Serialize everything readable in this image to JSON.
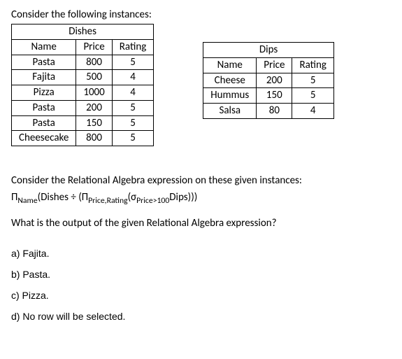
{
  "intro": "Consider the following instances:",
  "dishes": {
    "title": "Dishes",
    "headers": [
      "Name",
      "Price",
      "Rating"
    ],
    "rows": [
      {
        "name": "Pasta",
        "price": "800",
        "rating": "5"
      },
      {
        "name": "Fajita",
        "price": "500",
        "rating": "4"
      },
      {
        "name": "Pizza",
        "price": "1000",
        "rating": "4"
      },
      {
        "name": "Pasta",
        "price": "200",
        "rating": "5"
      },
      {
        "name": "Pasta",
        "price": "150",
        "rating": "5"
      },
      {
        "name": "Cheesecake",
        "price": "800",
        "rating": "5"
      }
    ]
  },
  "dips": {
    "title": "Dips",
    "headers": [
      "Name",
      "Price",
      "Rating"
    ],
    "rows": [
      {
        "name": "Cheese",
        "price": "200",
        "rating": "5"
      },
      {
        "name": "Hummus",
        "price": "150",
        "rating": "5"
      },
      {
        "name": "Salsa",
        "price": "80",
        "rating": "4"
      }
    ]
  },
  "expr_intro": "Consider the Relational Algebra expression on these given instances:",
  "expr": {
    "pi1": "Π",
    "sub1": "Name",
    "open1": "(Dishes ÷ (",
    "pi2": "Π",
    "sub2": "Price,Rating",
    "open2": "(",
    "sigma": "σ",
    "sub3": "Price>100",
    "rest": "Dips)))"
  },
  "question": "What is the output of the given Relational Algebra expression?",
  "options": {
    "a": "a) Fajita.",
    "b": "b) Pasta.",
    "c": "c) Pizza.",
    "d": "d) No row will be selected."
  }
}
